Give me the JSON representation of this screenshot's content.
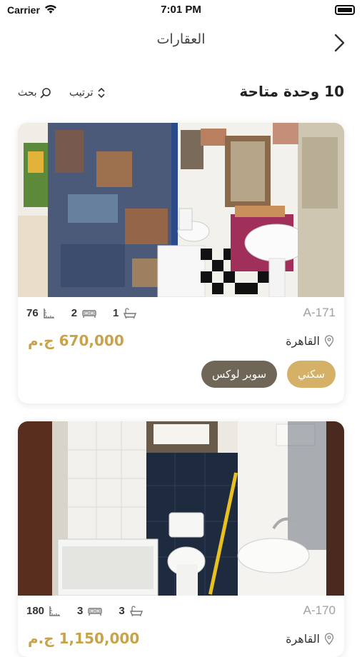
{
  "status": {
    "carrier": "Carrier",
    "time": "7:01 PM"
  },
  "nav": {
    "title": "العقارات",
    "back_icon": "chevron-right-icon"
  },
  "toolbar": {
    "count": "10 وحدة متاحة",
    "sort_label": "ترتيب",
    "search_label": "بحث"
  },
  "colors": {
    "accent": "#c9a34a",
    "tag_gold": "#d4b167",
    "tag_dark": "#6f6657"
  },
  "listings": [
    {
      "code": "A-171",
      "area": "76",
      "bedrooms": "2",
      "bathrooms": "1",
      "price": "670,000 ج.م",
      "location": "القاهرة",
      "tags": [
        "سكني",
        "سوبر لوكس"
      ]
    },
    {
      "code": "A-170",
      "area": "180",
      "bedrooms": "3",
      "bathrooms": "3",
      "price": "1,150,000 ج.م",
      "location": "القاهرة"
    }
  ]
}
